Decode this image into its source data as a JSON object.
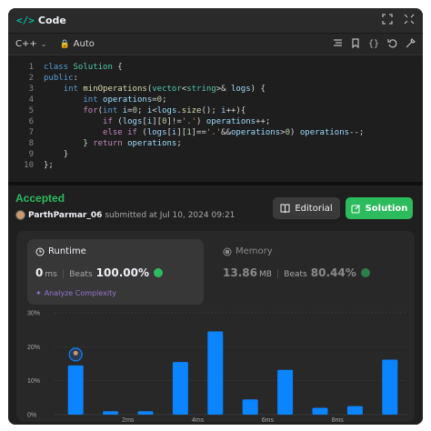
{
  "header": {
    "code_icon": "</>",
    "title": "Code",
    "icons": [
      "expand-icon",
      "fullscreen-icon"
    ]
  },
  "toolbar": {
    "language": "C++",
    "mode": "Auto",
    "icons": [
      "format-icon",
      "bookmark-icon",
      "braces-icon",
      "reset-icon",
      "settings-icon"
    ]
  },
  "code": {
    "line_numbers": [
      "1",
      "2",
      "3",
      "4",
      "5",
      "6",
      "7",
      "8",
      "9",
      "10"
    ]
  },
  "result": {
    "status": "Accepted",
    "username": "ParthParmar_06",
    "submitted_text": "submitted at Jul 10, 2024 09:21",
    "editorial_label": "Editorial",
    "solution_label": "Solution",
    "runtime": {
      "label": "Runtime",
      "value": "0",
      "unit": "ms",
      "beats_label": "Beats",
      "beats_value": "100.00%"
    },
    "analyze_label": "Analyze Complexity",
    "memory": {
      "label": "Memory",
      "value": "13.86",
      "unit": "MB",
      "beats_label": "Beats",
      "beats_value": "80.44%"
    }
  },
  "chart_data": {
    "type": "bar",
    "ylim": [
      0,
      30
    ],
    "y_ticks": [
      "30%",
      "20%",
      "10%",
      "0%"
    ],
    "x_tick_labels": [
      "2ms",
      "4ms",
      "6ms",
      "8ms"
    ],
    "values": [
      14.5,
      1.0,
      1.0,
      15.5,
      24.5,
      4.5,
      13.2,
      2.0,
      2.5,
      16.2
    ],
    "highlight_index": 0,
    "bar_color": "#0a84ff"
  }
}
